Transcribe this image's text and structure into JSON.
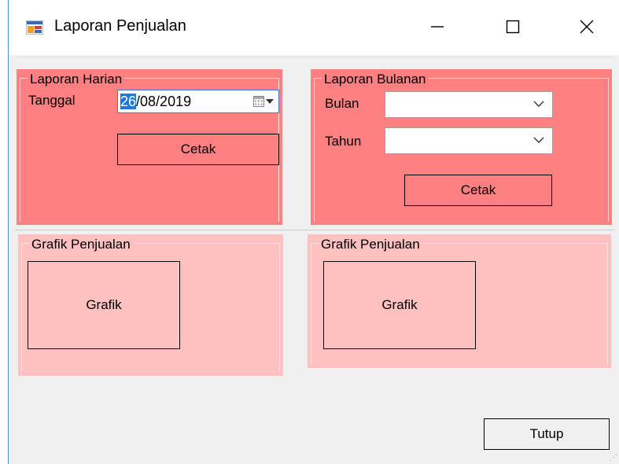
{
  "window": {
    "title": "Laporan Penjualan",
    "icon": "form-window-icon",
    "controls": [
      "minimize-icon",
      "maximize-icon",
      "close-icon"
    ]
  },
  "laporan_harian": {
    "legend": "Laporan Harian",
    "tanggal_label": "Tanggal",
    "date_selected": "26",
    "date_rest": "/08/2019",
    "calendar_icon": "calendar-icon",
    "cetak_label": "Cetak"
  },
  "laporan_bulanan": {
    "legend": "Laporan Bulanan",
    "bulan_label": "Bulan",
    "bulan_value": "",
    "tahun_label": "Tahun",
    "tahun_value": "",
    "cetak_label": "Cetak"
  },
  "grafik_left": {
    "legend": "Grafik Penjualan",
    "box_label": "Grafik"
  },
  "grafik_right": {
    "legend": "Grafik Penjualan",
    "box_label": "Grafik"
  },
  "footer": {
    "tutup_label": "Tutup"
  },
  "colors": {
    "panel_dark": "#ff8080",
    "panel_light": "#ffc0c0",
    "window_bg": "#f0f0f0",
    "selection": "#1e78d8"
  }
}
